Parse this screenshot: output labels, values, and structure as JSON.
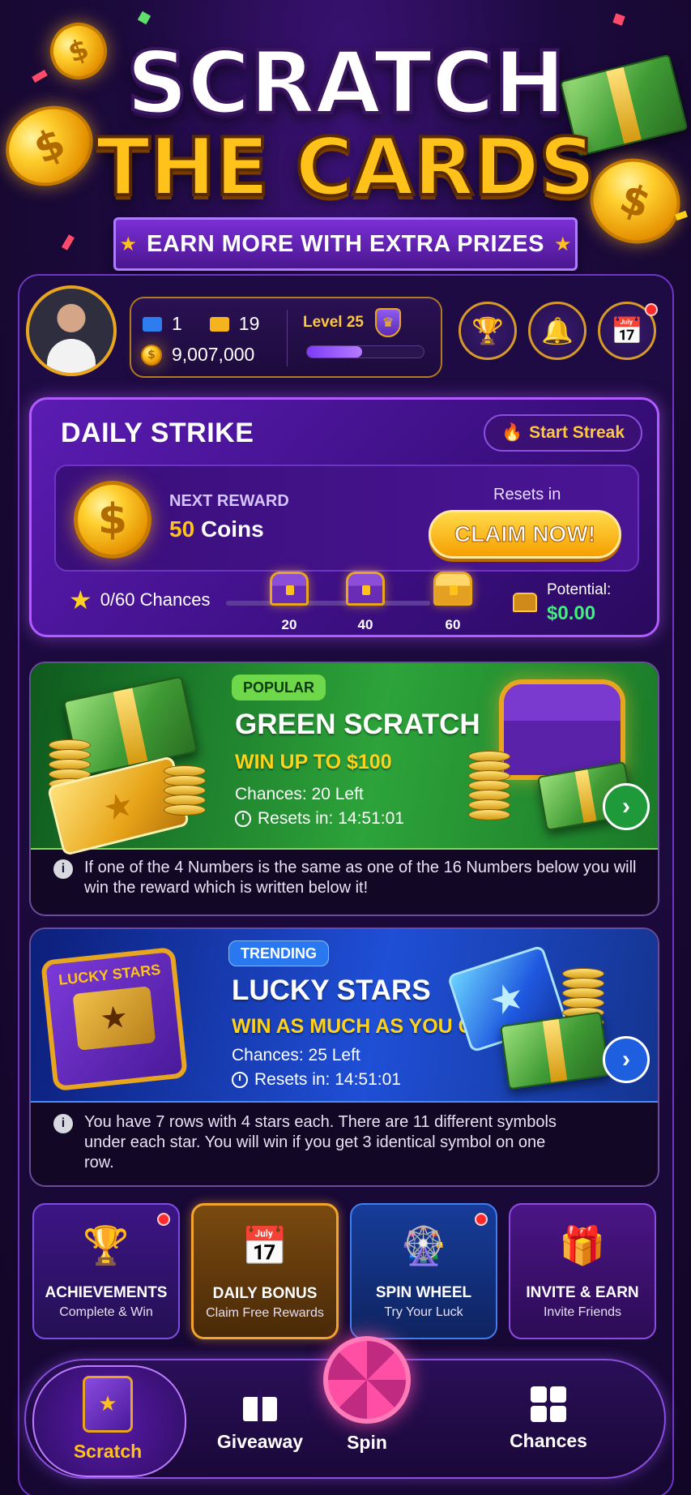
{
  "header": {
    "title_line1": "SCRATCH",
    "title_line2": "THE CARDS",
    "ribbon": "EARN MORE WITH EXTRA PRIZES"
  },
  "profile": {
    "tickets_blue": "1",
    "tickets_gold": "19",
    "coins": "9,007,000",
    "level": "Level 25",
    "xp_progress": 0.47
  },
  "actions": {
    "trophy_icon": "trophy-icon",
    "bell_icon": "bell-icon",
    "calendar_icon": "calendar-icon"
  },
  "daily_strike": {
    "title": "DAILY STRIKE",
    "streak_button": "Start Streak",
    "next_reward_label": "NEXT REWARD",
    "next_reward_amount": "50",
    "next_reward_unit": "Coins",
    "resets_label": "Resets in",
    "claim_button": "CLAIM NOW!",
    "chances": "0/60 Chances",
    "milestones": [
      "20",
      "40",
      "60"
    ],
    "potential_label": "Potential:",
    "potential_value": "$0.00"
  },
  "games": [
    {
      "tag": "POPULAR",
      "title": "GREEN SCRATCH",
      "subtitle": "WIN UP TO $100",
      "chances": "Chances: 20 Left",
      "resets": "Resets in: 14:51:01",
      "info": "If one of the 4 Numbers is the same as one of the 16 Numbers below you will win the reward which is written below it!"
    },
    {
      "tag": "TRENDING",
      "title": "LUCKY STARS",
      "subtitle": "WIN AS MUCH AS YOU CAN",
      "chances": "Chances: 25 Left",
      "resets": "Resets in: 14:51:01",
      "info": "You have 7 rows with 4 stars each. There are 11 different symbols under each star. You will win if you get 3 identical symbol on one row.",
      "card_label": "LUCKY STARS"
    }
  ],
  "tiles": [
    {
      "title": "ACHIEVEMENTS",
      "subtitle": "Complete & Win"
    },
    {
      "title": "DAILY BONUS",
      "subtitle": "Claim Free Rewards"
    },
    {
      "title": "SPIN WHEEL",
      "subtitle": "Try Your Luck"
    },
    {
      "title": "INVITE & EARN",
      "subtitle": "Invite Friends"
    }
  ],
  "nav": {
    "scratch": "Scratch",
    "giveaway": "Giveaway",
    "spin": "Spin",
    "chances": "Chances"
  },
  "colors": {
    "accent_gold": "#ffc21a",
    "accent_purple": "#b25cff",
    "potential_green": "#3df07a"
  }
}
